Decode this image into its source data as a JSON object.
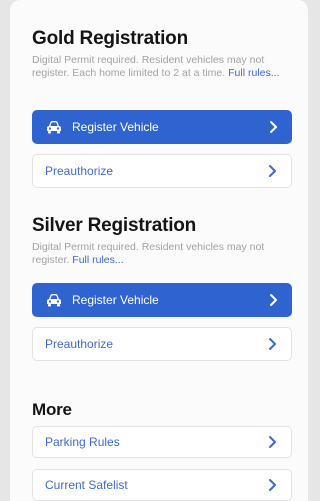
{
  "gold": {
    "title": "Gold Registration",
    "description": "Digital Permit required. Resident vehicles may not register. Each home limited to 2 at a time.",
    "rules_link": "Full rules...",
    "register_label": "Register Vehicle",
    "preauthorize_label": "Preauthorize"
  },
  "silver": {
    "title": "Silver Registration",
    "description": "Digital Permit required. Resident vehicles may not register.",
    "rules_link": "Full rules...",
    "register_label": "Register Vehicle",
    "preauthorize_label": "Preauthorize"
  },
  "more": {
    "title": "More",
    "items": [
      {
        "label": "Parking Rules"
      },
      {
        "label": "Current Safelist"
      }
    ]
  },
  "colors": {
    "accent": "#2f64d0",
    "link": "#3d6ad6",
    "muted_text": "#a3a3a3"
  },
  "icons": {
    "register": "car-icon",
    "row_arrow": "chevron-right-icon"
  }
}
